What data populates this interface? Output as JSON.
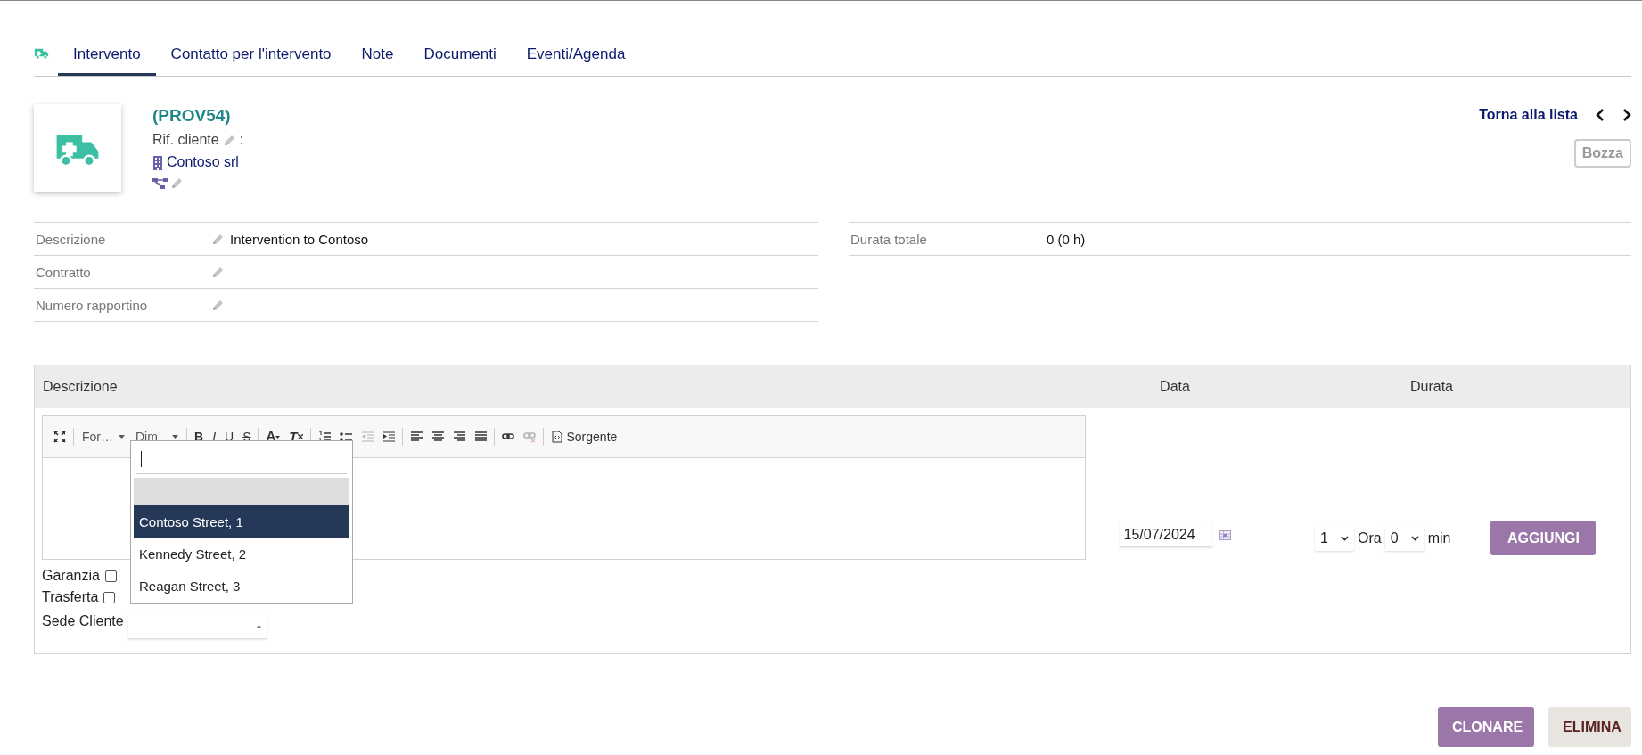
{
  "tabs": [
    {
      "kind": "icon",
      "selected": false
    },
    {
      "kind": "text",
      "label": "Intervento",
      "selected": true
    },
    {
      "kind": "text",
      "label": "Contatto per l'intervento",
      "selected": false
    },
    {
      "kind": "text",
      "label": "Note",
      "selected": false
    },
    {
      "kind": "text",
      "label": "Documenti",
      "selected": false
    },
    {
      "kind": "text",
      "label": "Eventi/Agenda",
      "selected": false
    }
  ],
  "header": {
    "code": "(PROV54)",
    "customer_ref_label": "Rif. cliente",
    "separator": ":",
    "company": "Contoso srl"
  },
  "navigation": {
    "back_link": "Torna alla lista"
  },
  "status": "Bozza",
  "fields_left": [
    {
      "label": "Descrizione",
      "value": "Intervention to Contoso"
    },
    {
      "label": "Contratto"
    },
    {
      "label": "Numero rapportino"
    }
  ],
  "fields_right": [
    {
      "label": "Durata totale",
      "value": "0 (0 h)"
    }
  ],
  "activity": {
    "columns": [
      "Descrizione",
      "Data",
      "Durata"
    ],
    "toolbar": [
      [
        {
          "kind": "maximize",
          "disabled": false
        }
      ],
      [
        {
          "kind": "combo",
          "label": "For…",
          "disabled": false
        },
        {
          "kind": "combo",
          "label": "Dim",
          "disabled": false
        }
      ],
      [
        {
          "kind": "bold",
          "label": "B",
          "disabled": false
        },
        {
          "kind": "italic",
          "label": "I",
          "disabled": false
        },
        {
          "kind": "underline",
          "label": "U",
          "disabled": false
        },
        {
          "kind": "strike",
          "label": "S",
          "disabled": false
        }
      ],
      [
        {
          "kind": "textcolor",
          "label": "A",
          "disabled": false
        },
        {
          "kind": "clearformat",
          "label": "T",
          "disabled": false
        }
      ],
      [
        {
          "kind": "numbered",
          "disabled": false
        },
        {
          "kind": "bulleted",
          "disabled": false
        },
        {
          "kind": "outdent",
          "disabled": true
        },
        {
          "kind": "indent",
          "disabled": false
        }
      ],
      [
        {
          "kind": "alignleft",
          "disabled": false
        },
        {
          "kind": "aligncenter",
          "disabled": false
        },
        {
          "kind": "alignright",
          "disabled": false
        },
        {
          "kind": "justify",
          "disabled": false
        }
      ],
      [
        {
          "kind": "link",
          "disabled": false
        },
        {
          "kind": "unlink",
          "disabled": true
        }
      ],
      [
        {
          "kind": "source",
          "label": "Sorgente",
          "disabled": false
        }
      ]
    ],
    "checkboxes": [
      {
        "label": "Garanzia",
        "checked": false
      },
      {
        "label": "Trasferta",
        "checked": false
      }
    ],
    "site_label": "Sede Cliente",
    "site_dropdown": {
      "expanded": true,
      "options": [
        {
          "kind": "blank",
          "selected": false
        },
        {
          "kind": "option",
          "label": "Contoso Street, 1",
          "selected": true
        },
        {
          "kind": "option",
          "label": "Kennedy Street, 2",
          "selected": false
        },
        {
          "kind": "option",
          "label": "Reagan Street, 3",
          "selected": false
        }
      ]
    },
    "date": "15/07/2024",
    "hours": "1",
    "hours_unit": "Ora",
    "minutes": "0",
    "minutes_unit": "min",
    "add_button": "AGGIUNGI"
  },
  "footer_buttons": [
    {
      "kind": "primary",
      "label": "CLONARE"
    },
    {
      "kind": "danger",
      "label": "ELIMINA"
    }
  ]
}
